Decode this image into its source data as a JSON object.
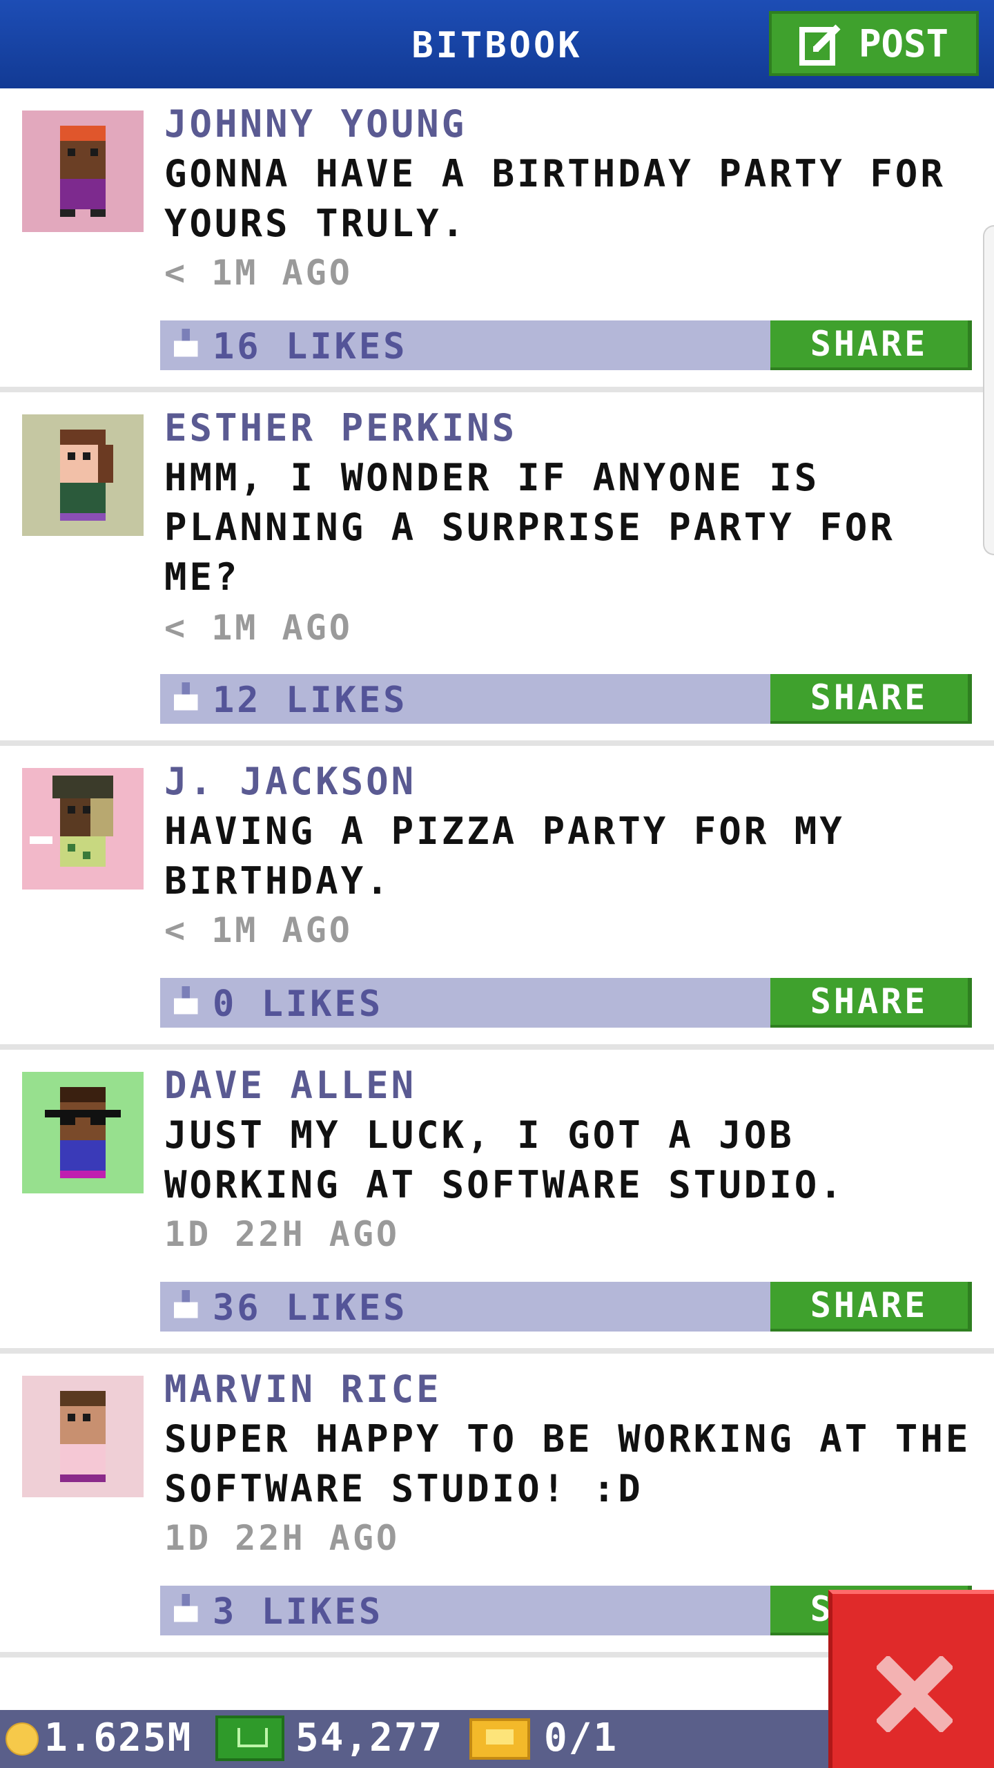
{
  "header": {
    "title": "BITBOOK",
    "post_label": "POST"
  },
  "posts": [
    {
      "name": "JOHNNY YOUNG",
      "message": "GONNA HAVE A BIRTHDAY PARTY FOR YOURS TRULY.",
      "time": "< 1M AGO",
      "likes": "16 LIKES",
      "share": "SHARE",
      "avatar_bg": "#e2a8bd"
    },
    {
      "name": "ESTHER PERKINS",
      "message": "HMM, I WONDER IF ANYONE IS PLANNING A SURPRISE PARTY FOR ME?",
      "time": "< 1M AGO",
      "likes": "12 LIKES",
      "share": "SHARE",
      "avatar_bg": "#c5c7a2"
    },
    {
      "name": "J. JACKSON",
      "message": "HAVING A PIZZA PARTY FOR MY BIRTHDAY.",
      "time": "< 1M AGO",
      "likes": "0 LIKES",
      "share": "SHARE",
      "avatar_bg": "#f2b8c9"
    },
    {
      "name": "DAVE ALLEN",
      "message": "JUST MY LUCK, I GOT A JOB WORKING AT SOFTWARE STUDIO.",
      "time": "1D 22H AGO",
      "likes": "36 LIKES",
      "share": "SHARE",
      "avatar_bg": "#97e08e"
    },
    {
      "name": "MARVIN RICE",
      "message": "SUPER HAPPY TO BE WORKING AT THE SOFTWARE STUDIO! :D",
      "time": "1D 22H AGO",
      "likes": "3 LIKES",
      "share": "SHARE",
      "avatar_bg": "#efcfd6"
    }
  ],
  "bottom_bar": {
    "coins": "1.625M",
    "cash": "54,277",
    "tickets": "0/1"
  },
  "icons": {
    "post": "edit-icon",
    "thumb": "thumbs-up-icon",
    "coin": "coin-icon",
    "cash": "cash-icon",
    "ticket": "ticket-icon",
    "close": "close-icon"
  }
}
